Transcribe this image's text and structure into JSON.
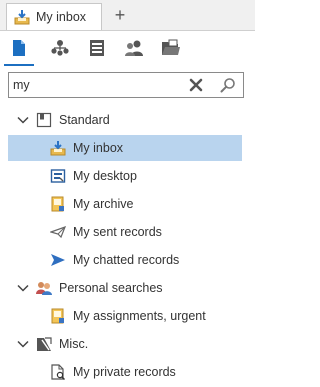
{
  "tab": {
    "label": "My inbox",
    "add_label": "+"
  },
  "toolbar": {
    "buttons": [
      {
        "name": "document-icon",
        "active": true
      },
      {
        "name": "org-chart-icon",
        "active": false
      },
      {
        "name": "list-icon",
        "active": false
      },
      {
        "name": "users-icon",
        "active": false
      },
      {
        "name": "folder-icon",
        "active": false
      }
    ]
  },
  "search": {
    "value": "my"
  },
  "tree": {
    "standard": {
      "label": "Standard",
      "items": [
        {
          "label": "My inbox",
          "icon": "inbox-icon",
          "selected": true
        },
        {
          "label": "My desktop",
          "icon": "desktop-icon"
        },
        {
          "label": "My archive",
          "icon": "archive-icon"
        },
        {
          "label": "My sent records",
          "icon": "sent-icon"
        },
        {
          "label": "My chatted records",
          "icon": "chat-arrow-icon"
        }
      ]
    },
    "personal": {
      "label": "Personal searches",
      "items": [
        {
          "label": "My assignments, urgent",
          "icon": "assignment-icon"
        }
      ]
    },
    "misc": {
      "label": "Misc.",
      "items": [
        {
          "label": "My private records",
          "icon": "private-record-icon"
        }
      ]
    }
  },
  "colors": {
    "accent": "#1c6fc1",
    "selection": "#b9d4ee"
  }
}
